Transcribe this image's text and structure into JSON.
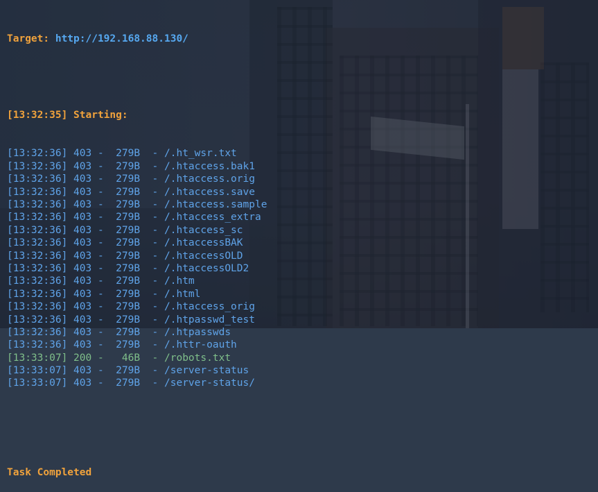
{
  "header": {
    "target_label": "Target:",
    "target_url": "http://192.168.88.130/",
    "starting_time": "[13:32:35]",
    "starting_label": "Starting:"
  },
  "results": [
    {
      "time": "[13:32:36]",
      "status": "403",
      "size": "279B",
      "path": "/.ht_wsr.txt"
    },
    {
      "time": "[13:32:36]",
      "status": "403",
      "size": "279B",
      "path": "/.htaccess.bak1"
    },
    {
      "time": "[13:32:36]",
      "status": "403",
      "size": "279B",
      "path": "/.htaccess.orig"
    },
    {
      "time": "[13:32:36]",
      "status": "403",
      "size": "279B",
      "path": "/.htaccess.save"
    },
    {
      "time": "[13:32:36]",
      "status": "403",
      "size": "279B",
      "path": "/.htaccess.sample"
    },
    {
      "time": "[13:32:36]",
      "status": "403",
      "size": "279B",
      "path": "/.htaccess_extra"
    },
    {
      "time": "[13:32:36]",
      "status": "403",
      "size": "279B",
      "path": "/.htaccess_sc"
    },
    {
      "time": "[13:32:36]",
      "status": "403",
      "size": "279B",
      "path": "/.htaccessBAK"
    },
    {
      "time": "[13:32:36]",
      "status": "403",
      "size": "279B",
      "path": "/.htaccessOLD"
    },
    {
      "time": "[13:32:36]",
      "status": "403",
      "size": "279B",
      "path": "/.htaccessOLD2"
    },
    {
      "time": "[13:32:36]",
      "status": "403",
      "size": "279B",
      "path": "/.htm"
    },
    {
      "time": "[13:32:36]",
      "status": "403",
      "size": "279B",
      "path": "/.html"
    },
    {
      "time": "[13:32:36]",
      "status": "403",
      "size": "279B",
      "path": "/.htaccess_orig"
    },
    {
      "time": "[13:32:36]",
      "status": "403",
      "size": "279B",
      "path": "/.htpasswd_test"
    },
    {
      "time": "[13:32:36]",
      "status": "403",
      "size": "279B",
      "path": "/.htpasswds"
    },
    {
      "time": "[13:32:36]",
      "status": "403",
      "size": "279B",
      "path": "/.httr-oauth"
    },
    {
      "time": "[13:33:07]",
      "status": "200",
      "size": "46B",
      "path": "/robots.txt"
    },
    {
      "time": "[13:33:07]",
      "status": "403",
      "size": "279B",
      "path": "/server-status"
    },
    {
      "time": "[13:33:07]",
      "status": "403",
      "size": "279B",
      "path": "/server-status/"
    }
  ],
  "footer": {
    "completed_label": "Task Completed"
  },
  "colors": {
    "orange": "#f0a23c",
    "blue": "#5fa3e8",
    "green": "#7fbf8a"
  }
}
